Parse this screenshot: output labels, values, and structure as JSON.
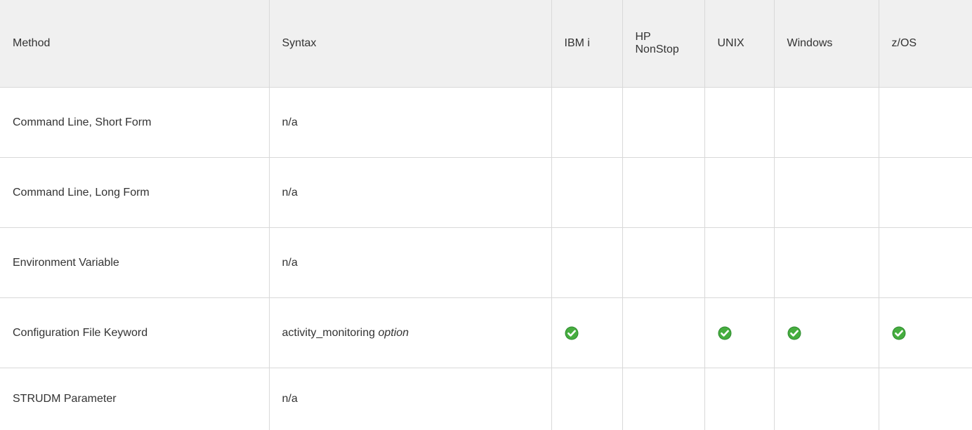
{
  "colors": {
    "header_bg": "#f0f0f0",
    "border": "#d9d9d9",
    "text": "#333333",
    "check_green": "#3fa63a"
  },
  "table": {
    "headers": {
      "method": "Method",
      "syntax": "Syntax",
      "ibmi": "IBM i",
      "hp_line1": "HP",
      "hp_line2": "NonStop",
      "unix": "UNIX",
      "windows": "Windows",
      "zos": "z/OS"
    },
    "rows": [
      {
        "method": "Command Line, Short Form",
        "syntax": "n/a",
        "supported": {
          "ibmi": false,
          "hp_nonstop": false,
          "unix": false,
          "windows": false,
          "zos": false
        }
      },
      {
        "method": "Command Line, Long Form",
        "syntax": "n/a",
        "supported": {
          "ibmi": false,
          "hp_nonstop": false,
          "unix": false,
          "windows": false,
          "zos": false
        }
      },
      {
        "method": "Environment Variable",
        "syntax": "n/a",
        "supported": {
          "ibmi": false,
          "hp_nonstop": false,
          "unix": false,
          "windows": false,
          "zos": false
        }
      },
      {
        "method": "Configuration File Keyword",
        "syntax_keyword": "activity_monitoring",
        "syntax_option": "option",
        "supported": {
          "ibmi": true,
          "hp_nonstop": false,
          "unix": true,
          "windows": true,
          "zos": true
        },
        "check_icon": "check-circle-icon"
      },
      {
        "method": "STRUDM Parameter",
        "syntax": "n/a",
        "supported": {
          "ibmi": false,
          "hp_nonstop": false,
          "unix": false,
          "windows": false,
          "zos": false
        }
      }
    ]
  }
}
